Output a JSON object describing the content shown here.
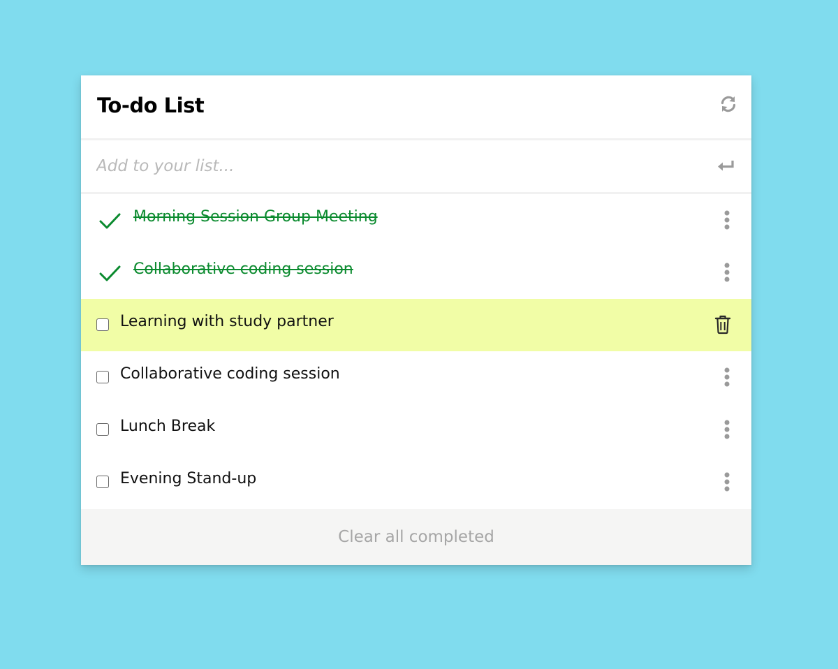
{
  "app": {
    "title": "To-do List"
  },
  "header": {
    "refresh_icon": "refresh-icon"
  },
  "add": {
    "placeholder": "Add to your list...",
    "value": "",
    "enter_icon": "enter-icon"
  },
  "items": [
    {
      "text": "Morning Session Group Meeting",
      "completed": true,
      "hovered": false
    },
    {
      "text": "Collaborative coding session",
      "completed": true,
      "hovered": false
    },
    {
      "text": "Learning with study partner",
      "completed": false,
      "hovered": true
    },
    {
      "text": "Collaborative coding session",
      "completed": false,
      "hovered": false
    },
    {
      "text": "Lunch Break",
      "completed": false,
      "hovered": false
    },
    {
      "text": "Evening Stand-up",
      "completed": false,
      "hovered": false
    }
  ],
  "footer": {
    "clear_label": "Clear all completed"
  },
  "colors": {
    "background": "#80dcee",
    "completed": "#0a8a2e",
    "hover_row": "#f1fda6",
    "icon_gray": "#9a9a9a"
  }
}
